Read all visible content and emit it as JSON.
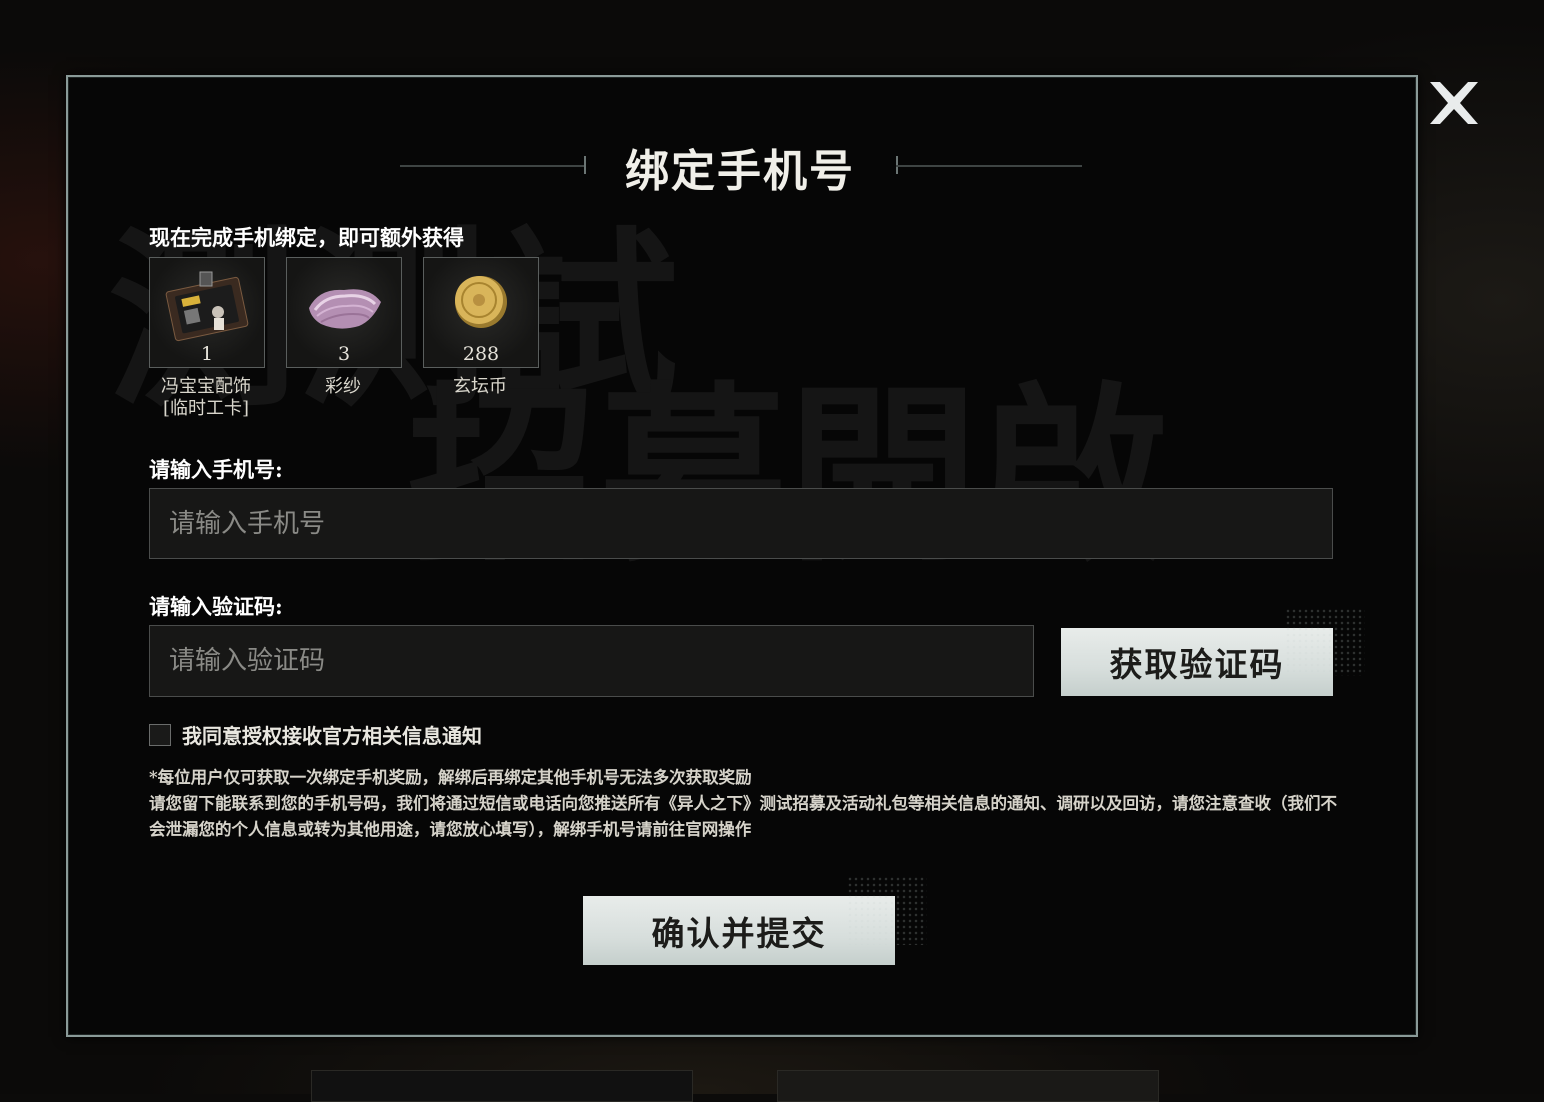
{
  "modal": {
    "title": "绑定手机号",
    "reward_hint": "现在完成手机绑定，即可额外获得",
    "rewards": [
      {
        "count": "1",
        "name_line1": "冯宝宝配饰",
        "name_line2": "[临时工卡]",
        "icon": "work-badge-icon"
      },
      {
        "count": "3",
        "name_line1": "彩纱",
        "name_line2": "",
        "icon": "colored-silk-icon"
      },
      {
        "count": "288",
        "name_line1": "玄坛币",
        "name_line2": "",
        "icon": "gold-coin-icon"
      }
    ],
    "phone": {
      "label": "请输入手机号:",
      "placeholder": "请输入手机号",
      "value": ""
    },
    "code": {
      "label": "请输入验证码:",
      "placeholder": "请输入验证码",
      "value": "",
      "get_code_button": "获取验证码"
    },
    "consent": {
      "checked": false,
      "label": "我同意授权接收官方相关信息通知"
    },
    "notice_line1": "*每位用户仅可获取一次绑定手机奖励，解绑后再绑定其他手机号无法多次获取奖励",
    "notice_line2": "请您留下能联系到您的手机号码，我们将通过短信或电话向您推送所有《异人之下》测试招募及活动礼包等相关信息的通知、调研以及回访，请您注意查收（我们不会泄漏您的个人信息或转为其他用途，请您放心填写），解绑手机号请前往官网操作",
    "submit_button": "确认并提交",
    "close_icon": "close-icon"
  },
  "colors": {
    "border": "#8a9a98",
    "button_bg": "#d7dedc",
    "modal_bg": "#060606"
  }
}
